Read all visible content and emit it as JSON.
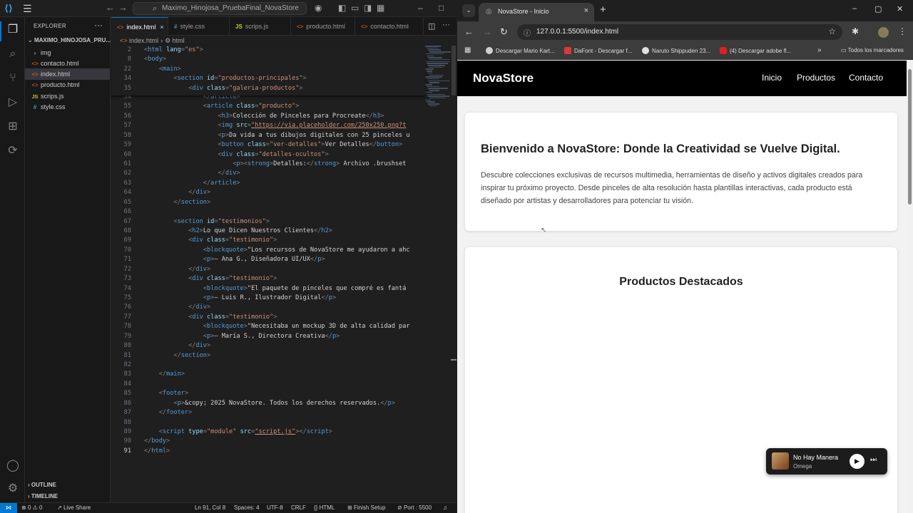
{
  "vscode": {
    "search_text": "Maximo_Hinojosa_PruebaFinal_NovaStore",
    "explorer_title": "EXPLORER",
    "project_root": "MAXIMO_HINOJOSA_PRU...",
    "files": [
      {
        "name": "img",
        "type": "folder"
      },
      {
        "name": "contacto.html",
        "type": "html"
      },
      {
        "name": "index.html",
        "type": "html"
      },
      {
        "name": "producto.html",
        "type": "html"
      },
      {
        "name": "scrips.js",
        "type": "js"
      },
      {
        "name": "style.css",
        "type": "css"
      }
    ],
    "outline_label": "OUTLINE",
    "timeline_label": "TIMELINE",
    "tabs": [
      {
        "label": "index.html",
        "icon": "html-file-icon"
      },
      {
        "label": "style.css",
        "icon": "css-file-icon"
      },
      {
        "label": "scrips.js",
        "icon": "js-file-icon"
      },
      {
        "label": "producto.html",
        "icon": "html-file-icon"
      },
      {
        "label": "contacto.html",
        "icon": "html-file-icon"
      }
    ],
    "breadcrumb": {
      "file": "index.html",
      "node": "html"
    },
    "status": {
      "errors": "0",
      "warnings": "0",
      "live_share": "Live Share",
      "position": "Ln 91, Col 8",
      "spaces": "Spaces: 4",
      "encoding": "UTF-8",
      "eol": "CRLF",
      "language": "HTML",
      "finish_setup": "Finish Setup",
      "port": "Port : 5500"
    }
  },
  "code_sticky": [
    {
      "n": "2",
      "indent": "",
      "segs": [
        [
          "br",
          "<"
        ],
        [
          "tag",
          "html "
        ],
        [
          "attr",
          "lang"
        ],
        [
          "br",
          "="
        ],
        [
          "val",
          "\"es\""
        ],
        [
          "br",
          ">"
        ]
      ]
    },
    {
      "n": "8",
      "indent": "",
      "segs": [
        [
          "br",
          "<"
        ],
        [
          "tag",
          "body"
        ],
        [
          "br",
          ">"
        ]
      ]
    },
    {
      "n": "22",
      "indent": "    ",
      "segs": [
        [
          "br",
          "<"
        ],
        [
          "tag",
          "main"
        ],
        [
          "br",
          ">"
        ]
      ]
    },
    {
      "n": "34",
      "indent": "        ",
      "segs": [
        [
          "br",
          "<"
        ],
        [
          "tag",
          "section "
        ],
        [
          "attr",
          "id"
        ],
        [
          "br",
          "="
        ],
        [
          "val",
          "\"productos-principales\""
        ],
        [
          "br",
          ">"
        ]
      ]
    },
    {
      "n": "35",
      "indent": "            ",
      "segs": [
        [
          "br",
          "<"
        ],
        [
          "tag",
          "div "
        ],
        [
          "attr",
          "class"
        ],
        [
          "br",
          "="
        ],
        [
          "val",
          "\"galeria-productos\""
        ],
        [
          "br",
          ">"
        ]
      ]
    }
  ],
  "code_lines": [
    {
      "n": "54",
      "indent": "                ",
      "segs": [
        [
          "br",
          "</"
        ],
        [
          "tag",
          "article"
        ],
        [
          "br",
          ">"
        ]
      ]
    },
    {
      "n": "55",
      "indent": "                ",
      "segs": [
        [
          "br",
          "<"
        ],
        [
          "tag",
          "article "
        ],
        [
          "attr",
          "class"
        ],
        [
          "br",
          "="
        ],
        [
          "val",
          "\"producto\""
        ],
        [
          "br",
          ">"
        ]
      ]
    },
    {
      "n": "56",
      "indent": "                    ",
      "segs": [
        [
          "br",
          "<"
        ],
        [
          "tag",
          "h3"
        ],
        [
          "br",
          ">"
        ],
        [
          "txt",
          "Colección de Pinceles para Procreate"
        ],
        [
          "br",
          "</"
        ],
        [
          "tag",
          "h3"
        ],
        [
          "br",
          ">"
        ]
      ]
    },
    {
      "n": "57",
      "indent": "                    ",
      "segs": [
        [
          "br",
          "<"
        ],
        [
          "tag",
          "img "
        ],
        [
          "attr",
          "src"
        ],
        [
          "br",
          "="
        ],
        [
          "url",
          "\"https://via.placeholder.com/250x250.png?t"
        ]
      ]
    },
    {
      "n": "58",
      "indent": "                    ",
      "segs": [
        [
          "br",
          "<"
        ],
        [
          "tag",
          "p"
        ],
        [
          "br",
          ">"
        ],
        [
          "txt",
          "Da vida a tus dibujos digitales con 25 pinceles u"
        ]
      ]
    },
    {
      "n": "59",
      "indent": "                    ",
      "segs": [
        [
          "br",
          "<"
        ],
        [
          "tag",
          "button "
        ],
        [
          "attr",
          "class"
        ],
        [
          "br",
          "="
        ],
        [
          "val",
          "\"ver-detalles\""
        ],
        [
          "br",
          ">"
        ],
        [
          "txt",
          "Ver Detalles"
        ],
        [
          "br",
          "</"
        ],
        [
          "tag",
          "button"
        ],
        [
          "br",
          ">"
        ]
      ]
    },
    {
      "n": "60",
      "indent": "                    ",
      "segs": [
        [
          "br",
          "<"
        ],
        [
          "tag",
          "div "
        ],
        [
          "attr",
          "class"
        ],
        [
          "br",
          "="
        ],
        [
          "val",
          "\"detalles-ocultos\""
        ],
        [
          "br",
          ">"
        ]
      ]
    },
    {
      "n": "61",
      "indent": "                        ",
      "segs": [
        [
          "br",
          "<"
        ],
        [
          "tag",
          "p"
        ],
        [
          "br",
          "><"
        ],
        [
          "tag",
          "strong"
        ],
        [
          "br",
          ">"
        ],
        [
          "txt",
          "Detalles:"
        ],
        [
          "br",
          "</"
        ],
        [
          "tag",
          "strong"
        ],
        [
          "br",
          "> "
        ],
        [
          "txt",
          "Archivo .brushset"
        ]
      ]
    },
    {
      "n": "62",
      "indent": "                    ",
      "segs": [
        [
          "br",
          "</"
        ],
        [
          "tag",
          "div"
        ],
        [
          "br",
          ">"
        ]
      ]
    },
    {
      "n": "63",
      "indent": "                ",
      "segs": [
        [
          "br",
          "</"
        ],
        [
          "tag",
          "article"
        ],
        [
          "br",
          ">"
        ]
      ]
    },
    {
      "n": "64",
      "indent": "            ",
      "segs": [
        [
          "br",
          "</"
        ],
        [
          "tag",
          "div"
        ],
        [
          "br",
          ">"
        ]
      ]
    },
    {
      "n": "65",
      "indent": "        ",
      "segs": [
        [
          "br",
          "</"
        ],
        [
          "tag",
          "section"
        ],
        [
          "br",
          ">"
        ]
      ]
    },
    {
      "n": "66",
      "indent": "",
      "segs": []
    },
    {
      "n": "67",
      "indent": "        ",
      "segs": [
        [
          "br",
          "<"
        ],
        [
          "tag",
          "section "
        ],
        [
          "attr",
          "id"
        ],
        [
          "br",
          "="
        ],
        [
          "val",
          "\"testimonios\""
        ],
        [
          "br",
          ">"
        ]
      ]
    },
    {
      "n": "68",
      "indent": "            ",
      "segs": [
        [
          "br",
          "<"
        ],
        [
          "tag",
          "h2"
        ],
        [
          "br",
          ">"
        ],
        [
          "txt",
          "Lo que Dicen Nuestros Clientes"
        ],
        [
          "br",
          "</"
        ],
        [
          "tag",
          "h2"
        ],
        [
          "br",
          ">"
        ]
      ]
    },
    {
      "n": "69",
      "indent": "            ",
      "segs": [
        [
          "br",
          "<"
        ],
        [
          "tag",
          "div "
        ],
        [
          "attr",
          "class"
        ],
        [
          "br",
          "="
        ],
        [
          "val",
          "\"testimonio\""
        ],
        [
          "br",
          ">"
        ]
      ]
    },
    {
      "n": "70",
      "indent": "                ",
      "segs": [
        [
          "br",
          "<"
        ],
        [
          "tag",
          "blockquote"
        ],
        [
          "br",
          ">"
        ],
        [
          "txt",
          "\"Los recursos de NovaStore me ayudaron a ahc"
        ]
      ]
    },
    {
      "n": "71",
      "indent": "                ",
      "segs": [
        [
          "br",
          "<"
        ],
        [
          "tag",
          "p"
        ],
        [
          "br",
          ">"
        ],
        [
          "txt",
          "— Ana G., Diseñadora UI/UX"
        ],
        [
          "br",
          "</"
        ],
        [
          "tag",
          "p"
        ],
        [
          "br",
          ">"
        ]
      ]
    },
    {
      "n": "72",
      "indent": "            ",
      "segs": [
        [
          "br",
          "</"
        ],
        [
          "tag",
          "div"
        ],
        [
          "br",
          ">"
        ]
      ]
    },
    {
      "n": "73",
      "indent": "            ",
      "segs": [
        [
          "br",
          "<"
        ],
        [
          "tag",
          "div "
        ],
        [
          "attr",
          "class"
        ],
        [
          "br",
          "="
        ],
        [
          "val",
          "\"testimonio\""
        ],
        [
          "br",
          ">"
        ]
      ]
    },
    {
      "n": "74",
      "indent": "                ",
      "segs": [
        [
          "br",
          "<"
        ],
        [
          "tag",
          "blockquote"
        ],
        [
          "br",
          ">"
        ],
        [
          "txt",
          "\"El paquete de pinceles que compré es fantá"
        ]
      ]
    },
    {
      "n": "75",
      "indent": "                ",
      "segs": [
        [
          "br",
          "<"
        ],
        [
          "tag",
          "p"
        ],
        [
          "br",
          ">"
        ],
        [
          "txt",
          "— Luis R., Ilustrador Digital"
        ],
        [
          "br",
          "</"
        ],
        [
          "tag",
          "p"
        ],
        [
          "br",
          ">"
        ]
      ]
    },
    {
      "n": "76",
      "indent": "            ",
      "segs": [
        [
          "br",
          "</"
        ],
        [
          "tag",
          "div"
        ],
        [
          "br",
          ">"
        ]
      ]
    },
    {
      "n": "77",
      "indent": "            ",
      "segs": [
        [
          "br",
          "<"
        ],
        [
          "tag",
          "div "
        ],
        [
          "attr",
          "class"
        ],
        [
          "br",
          "="
        ],
        [
          "val",
          "\"testimonio\""
        ],
        [
          "br",
          ">"
        ]
      ]
    },
    {
      "n": "78",
      "indent": "                ",
      "segs": [
        [
          "br",
          "<"
        ],
        [
          "tag",
          "blockquote"
        ],
        [
          "br",
          ">"
        ],
        [
          "txt",
          "\"Necesitaba un mockup 3D de alta calidad par"
        ]
      ]
    },
    {
      "n": "79",
      "indent": "                ",
      "segs": [
        [
          "br",
          "<"
        ],
        [
          "tag",
          "p"
        ],
        [
          "br",
          ">"
        ],
        [
          "txt",
          "— María S., Directora Creativa"
        ],
        [
          "br",
          "</"
        ],
        [
          "tag",
          "p"
        ],
        [
          "br",
          ">"
        ]
      ]
    },
    {
      "n": "80",
      "indent": "            ",
      "segs": [
        [
          "br",
          "</"
        ],
        [
          "tag",
          "div"
        ],
        [
          "br",
          ">"
        ]
      ]
    },
    {
      "n": "81",
      "indent": "        ",
      "segs": [
        [
          "br",
          "</"
        ],
        [
          "tag",
          "section"
        ],
        [
          "br",
          ">"
        ]
      ]
    },
    {
      "n": "82",
      "indent": "",
      "segs": []
    },
    {
      "n": "83",
      "indent": "    ",
      "segs": [
        [
          "br",
          "</"
        ],
        [
          "tag",
          "main"
        ],
        [
          "br",
          ">"
        ]
      ]
    },
    {
      "n": "84",
      "indent": "",
      "segs": []
    },
    {
      "n": "85",
      "indent": "    ",
      "segs": [
        [
          "br",
          "<"
        ],
        [
          "tag",
          "footer"
        ],
        [
          "br",
          ">"
        ]
      ]
    },
    {
      "n": "86",
      "indent": "        ",
      "segs": [
        [
          "br",
          "<"
        ],
        [
          "tag",
          "p"
        ],
        [
          "br",
          ">"
        ],
        [
          "txt",
          "&copy; 2025 NovaStore. Todos los derechos reservados."
        ],
        [
          "br",
          "</"
        ],
        [
          "tag",
          "p"
        ],
        [
          "br",
          ">"
        ]
      ]
    },
    {
      "n": "87",
      "indent": "    ",
      "segs": [
        [
          "br",
          "</"
        ],
        [
          "tag",
          "footer"
        ],
        [
          "br",
          ">"
        ]
      ]
    },
    {
      "n": "88",
      "indent": "",
      "segs": []
    },
    {
      "n": "89",
      "indent": "    ",
      "segs": [
        [
          "br",
          "<"
        ],
        [
          "tag",
          "script "
        ],
        [
          "attr",
          "type"
        ],
        [
          "br",
          "="
        ],
        [
          "val",
          "\"module\" "
        ],
        [
          "attr",
          "src"
        ],
        [
          "br",
          "="
        ],
        [
          "url",
          "\"script.js\""
        ],
        [
          "br",
          "></"
        ],
        [
          "tag",
          "script"
        ],
        [
          "br",
          ">"
        ]
      ]
    },
    {
      "n": "90",
      "indent": "",
      "segs": [
        [
          "br",
          "</"
        ],
        [
          "tag",
          "body"
        ],
        [
          "br",
          ">"
        ]
      ]
    },
    {
      "n": "91",
      "indent": "",
      "segs": [
        [
          "br",
          "</"
        ],
        [
          "tag",
          "html"
        ],
        [
          "br",
          ">"
        ]
      ]
    }
  ],
  "browser": {
    "tab_title": "NovaStore - Inicio",
    "url": "127.0.0.1:5500/index.html",
    "bookmarks": [
      {
        "label": "Descargar Mario Kart...",
        "color": "#d0d0d0"
      },
      {
        "label": "DaFont - Descargar f...",
        "color": "#d83a3a"
      },
      {
        "label": "Naruto Shippuden 23...",
        "color": "#e0e0e0"
      },
      {
        "label": "(4) Descargar adobe fl...",
        "color": "#e02020"
      }
    ],
    "all_bookmarks": "Todos los marcadores"
  },
  "site": {
    "logo": "NovaStore",
    "nav": [
      "Inicio",
      "Productos",
      "Contacto"
    ],
    "hero_title": "Bienvenido a NovaStore: Donde la Creatividad se Vuelve Digital.",
    "hero_text": "Descubre colecciones exclusivas de recursos multimedia, herramientas de diseño y activos digitales creados para inspirar tu próximo proyecto. Desde pinceles de alta resolución hasta plantillas interactivas, cada producto está diseñado por artistas y desarrolladores para potenciar tu visión.",
    "featured_title": "Productos Destacados"
  },
  "media": {
    "song": "No Hay Manera",
    "artist": "Omega"
  }
}
